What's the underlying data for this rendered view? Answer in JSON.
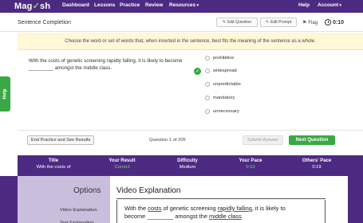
{
  "nav": {
    "logo_pre": "Mag",
    "logo_check": "✓",
    "logo_post": "sh",
    "items": [
      "Dashboard",
      "Lessons",
      "Practice",
      "Review",
      "Resources"
    ],
    "help": "Help",
    "account": "Account"
  },
  "header": {
    "title": "Sentence Completion",
    "edit_question": "Edit Question",
    "edit_prompt": "Edit Prompt",
    "flag": "Flag",
    "timer": "0:10"
  },
  "instruction": "Choose the word or set of words that, when inserted in the sentence, best fits the meaning of the sentence as a whole.",
  "question": {
    "text": "With the costs of genetic screening rapidly falling, it is likely to become _________ amongst the middle class."
  },
  "choices": [
    "prohibitive",
    "widespread",
    "unpredictable",
    "mandatory",
    "unnecessary"
  ],
  "selected_choice": "widespread",
  "help_tab": "Help",
  "footer": {
    "end_button": "End Practice and See Results",
    "counter": "Question 1 of 205",
    "submit": "Submit Answer",
    "next": "Next Question"
  },
  "stats": [
    {
      "label": "Title",
      "value": "With the costs of"
    },
    {
      "label": "Your Result",
      "value": "Correct"
    },
    {
      "label": "Difficulty",
      "value": "Medium"
    },
    {
      "label": "Your Pace",
      "value": "0:10"
    },
    {
      "label": "Others' Pace",
      "value": "0:19"
    }
  ],
  "options": {
    "title": "Options",
    "link1": "Video Explanation",
    "link2": "Text Explanation"
  },
  "video": {
    "title": "Video Explanation",
    "line1_a": "With the ",
    "line1_b": "costs",
    "line1_c": " of genetic screening ",
    "line1_d": "rapidly falling",
    "line1_e": ", it is likely to",
    "line2_a": "become ________ amongst the ",
    "line2_b": "middle class",
    "line2_c": "."
  },
  "colors": {
    "brand_purple": "#4d2a82",
    "accent_green": "#3aa845",
    "instruction_bg": "#fff7d6",
    "options_bg": "#c9bfdc"
  }
}
